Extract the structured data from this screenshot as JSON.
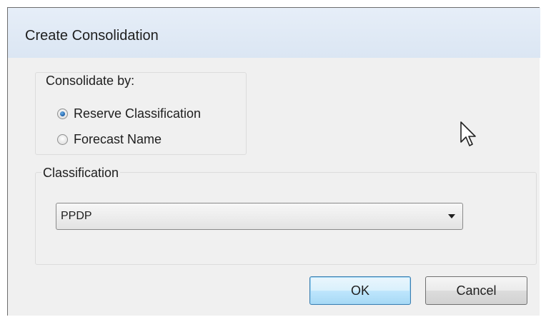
{
  "window": {
    "title": "Create Consolidation"
  },
  "consolidate_group": {
    "label": "Consolidate by:",
    "options": [
      {
        "label": "Reserve Classification",
        "selected": true
      },
      {
        "label": "Forecast Name",
        "selected": false
      }
    ]
  },
  "classification_group": {
    "label": "Classification",
    "selected_value": "PPDP"
  },
  "buttons": {
    "ok_label": "OK",
    "cancel_label": "Cancel"
  },
  "icons": {
    "cursor": "mouse-pointer-icon",
    "dropdown": "chevron-down-icon"
  },
  "colors": {
    "title_bar": "#dbe6f3",
    "dialog_background": "#f0f0f0",
    "radio_accent": "#1b5fa8",
    "ok_button_focus": "#3c7fb1"
  }
}
